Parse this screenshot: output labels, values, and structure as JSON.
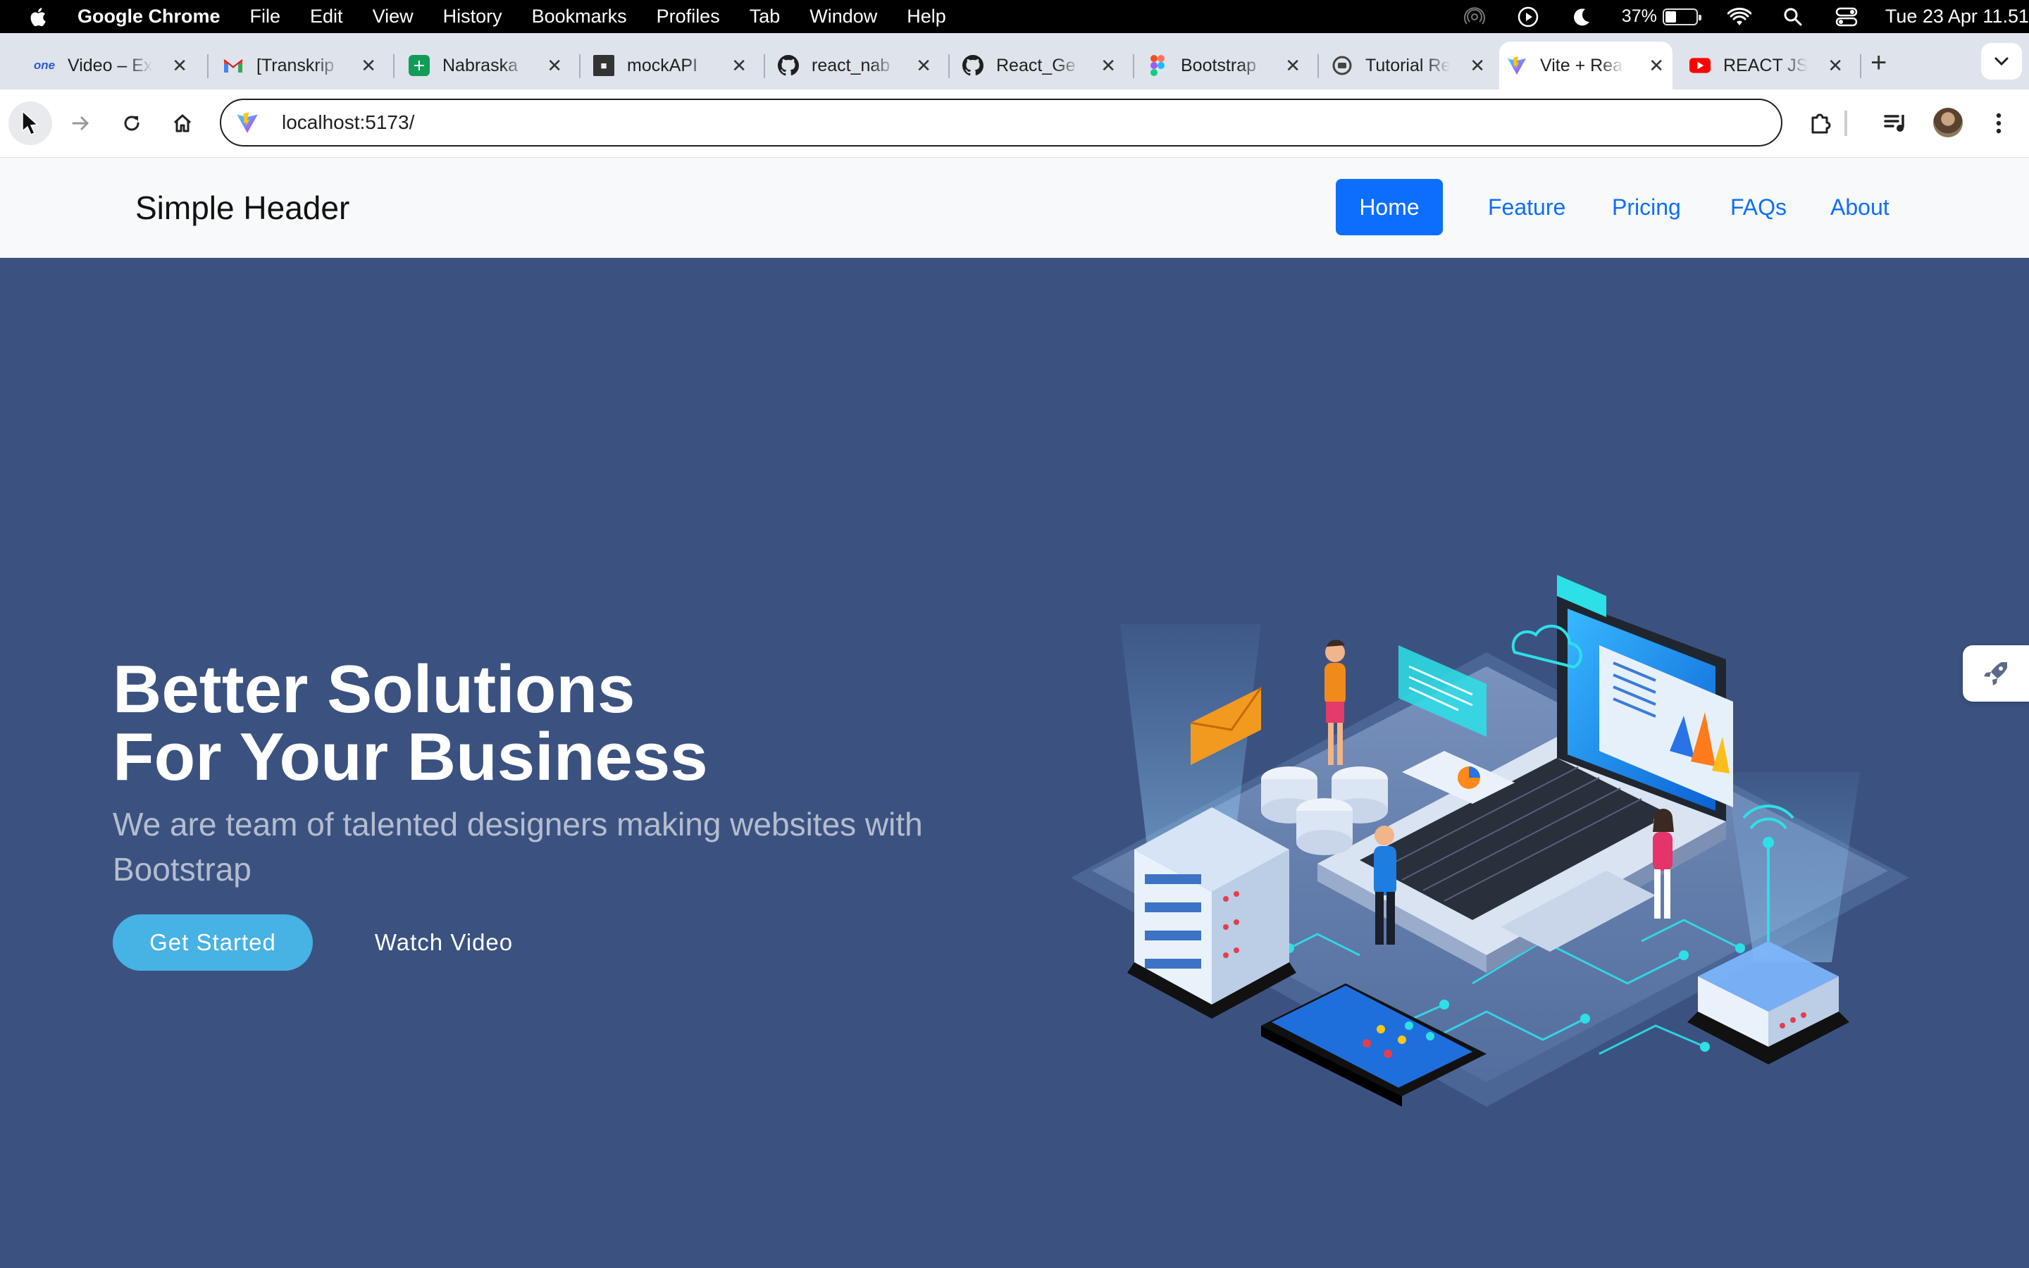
{
  "menubar": {
    "app_name": "Google Chrome",
    "items": [
      "File",
      "Edit",
      "View",
      "History",
      "Bookmarks",
      "Profiles",
      "Tab",
      "Window",
      "Help"
    ],
    "battery_percent": "37%",
    "battery_level": 0.37,
    "clock": "Tue 23 Apr  11.51"
  },
  "tabs": [
    {
      "title": "Video – Ex",
      "favicon": "one-icon",
      "color": "#2b5bd7"
    },
    {
      "title": "[Transkrip",
      "favicon": "gmail-icon",
      "color": "#ea4335"
    },
    {
      "title": "Nabraska",
      "favicon": "sheets-icon",
      "color": "#0f9d58"
    },
    {
      "title": "mockAPI",
      "favicon": "mockapi-icon",
      "color": "#333333"
    },
    {
      "title": "react_nab",
      "favicon": "github-icon",
      "color": "#1f1f1f"
    },
    {
      "title": "React_Ge",
      "favicon": "github-icon",
      "color": "#1f1f1f"
    },
    {
      "title": "Bootstrap",
      "favicon": "figma-icon",
      "color": "#f24e1e"
    },
    {
      "title": "Tutorial Re",
      "favicon": "tutorial-icon",
      "color": "#444444"
    },
    {
      "title": "Vite + Rea",
      "favicon": "vite-icon",
      "color": "#7b61ff"
    },
    {
      "title": "REACT JS",
      "favicon": "youtube-icon",
      "color": "#ff0000"
    }
  ],
  "active_tab_index": 8,
  "address_bar": {
    "url": "localhost:5173/"
  },
  "site": {
    "brand": "Simple Header",
    "nav": [
      {
        "label": "Home",
        "active": true
      },
      {
        "label": "Feature",
        "active": false
      },
      {
        "label": "Pricing",
        "active": false
      },
      {
        "label": "FAQs",
        "active": false
      },
      {
        "label": "About",
        "active": false
      }
    ]
  },
  "hero": {
    "title_line1": "Better Solutions",
    "title_line2": "For Your Business",
    "subtitle": "We are team of talented designers making websites with Bootstrap",
    "primary_button": "Get Started",
    "secondary_button": "Watch Video"
  },
  "colors": {
    "hero_bg": "#3b5280",
    "primary_button": "#47b2e4",
    "nav_link": "#0d6efd",
    "header_bg": "#f8f9fa"
  }
}
